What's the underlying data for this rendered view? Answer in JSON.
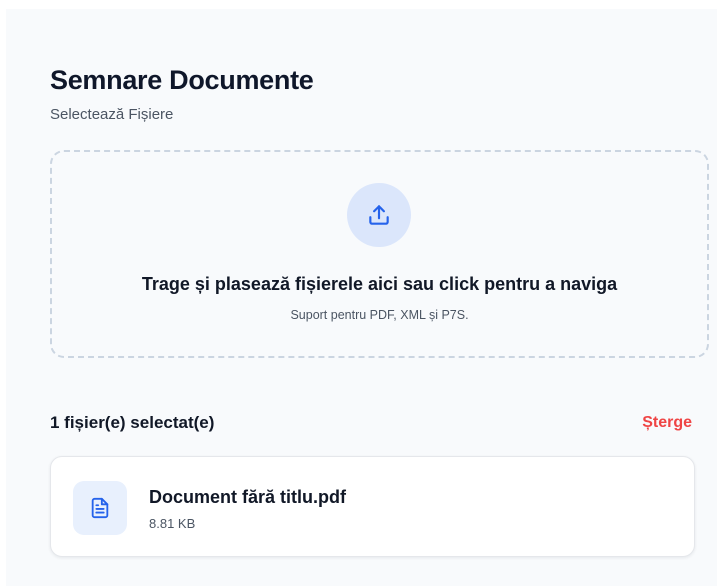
{
  "header": {
    "title": "Semnare Documente",
    "subtitle": "Selectează Fișiere"
  },
  "dropzone": {
    "icon": "upload-icon",
    "title": "Trage și plasează fișierele aici sau click pentru a naviga",
    "subtitle": "Suport pentru PDF, XML și P7S."
  },
  "selection": {
    "count_label": "1 fișier(e) selectat(e)",
    "clear_label": "Șterge"
  },
  "files": [
    {
      "icon": "document-icon",
      "name": "Document fără titlu.pdf",
      "size": "8.81 KB"
    }
  ],
  "colors": {
    "accent": "#2563eb",
    "icon_circle": "#dbe6fb",
    "danger": "#ef4444",
    "border_dashed": "#cbd5e1"
  }
}
